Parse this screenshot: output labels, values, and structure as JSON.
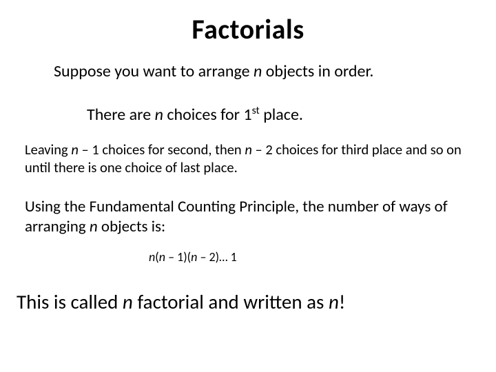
{
  "title": "Factorials",
  "suppose": {
    "pre": "Suppose you want to arrange ",
    "var": "n",
    "post": " objects in order."
  },
  "there": {
    "pre": "There are ",
    "var": "n",
    "mid": " choices for 1",
    "sup": "st",
    "post": " place."
  },
  "leaving": {
    "pre": "Leaving ",
    "var1": "n",
    "mid1": " – 1 choices for second, then ",
    "var2": "n",
    "mid2": " – 2 choices for third place and so on until there is one choice of last place."
  },
  "using": {
    "pre": "Using the Fundamental Counting Principle, the number of ways of arranging ",
    "var": "n",
    "post": " objects is:"
  },
  "formula": {
    "n1": "n",
    "p1": "(",
    "n2": "n",
    "p2": " – 1)(",
    "n3": "n",
    "p3": " – 2)… 1"
  },
  "final": {
    "pre": "This is called ",
    "var1": "n",
    "mid": " factorial and written as ",
    "var2": "n",
    "post": "!"
  }
}
